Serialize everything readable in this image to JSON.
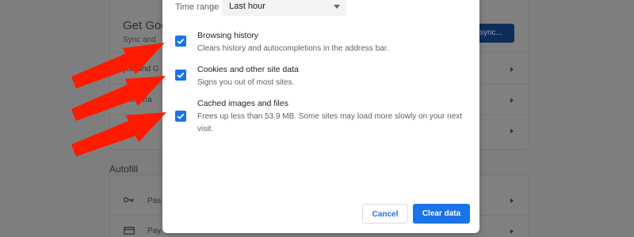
{
  "background_page": {
    "heading": "Get Goo",
    "subtitle": "Sync and",
    "sync_button": "sync...",
    "rows": [
      "ync and G",
      "rome na",
      "rt boo"
    ],
    "autofill_heading": "Autofill",
    "autofill_rows": [
      "Pas",
      "Pay"
    ]
  },
  "dialog": {
    "time_range_label": "Time range",
    "time_range_value": "Last hour",
    "options": [
      {
        "title": "Browsing history",
        "description": "Clears history and autocompletions in the address bar.",
        "checked": true
      },
      {
        "title": "Cookies and other site data",
        "description": "Signs you out of most sites.",
        "checked": true
      },
      {
        "title": "Cached images and files",
        "description": "Frees up less than 53.9 MB. Some sites may load more slowly on your next visit.",
        "checked": true
      }
    ],
    "cancel_label": "Cancel",
    "clear_label": "Clear data"
  },
  "colors": {
    "accent": "#1a73e8",
    "arrow": "#ff1a00",
    "overlay": "#7f7f7f"
  },
  "icons": [
    "check-icon",
    "key-icon",
    "card-icon",
    "chevron-right-icon",
    "chevron-down-icon",
    "arrow-annotation"
  ]
}
